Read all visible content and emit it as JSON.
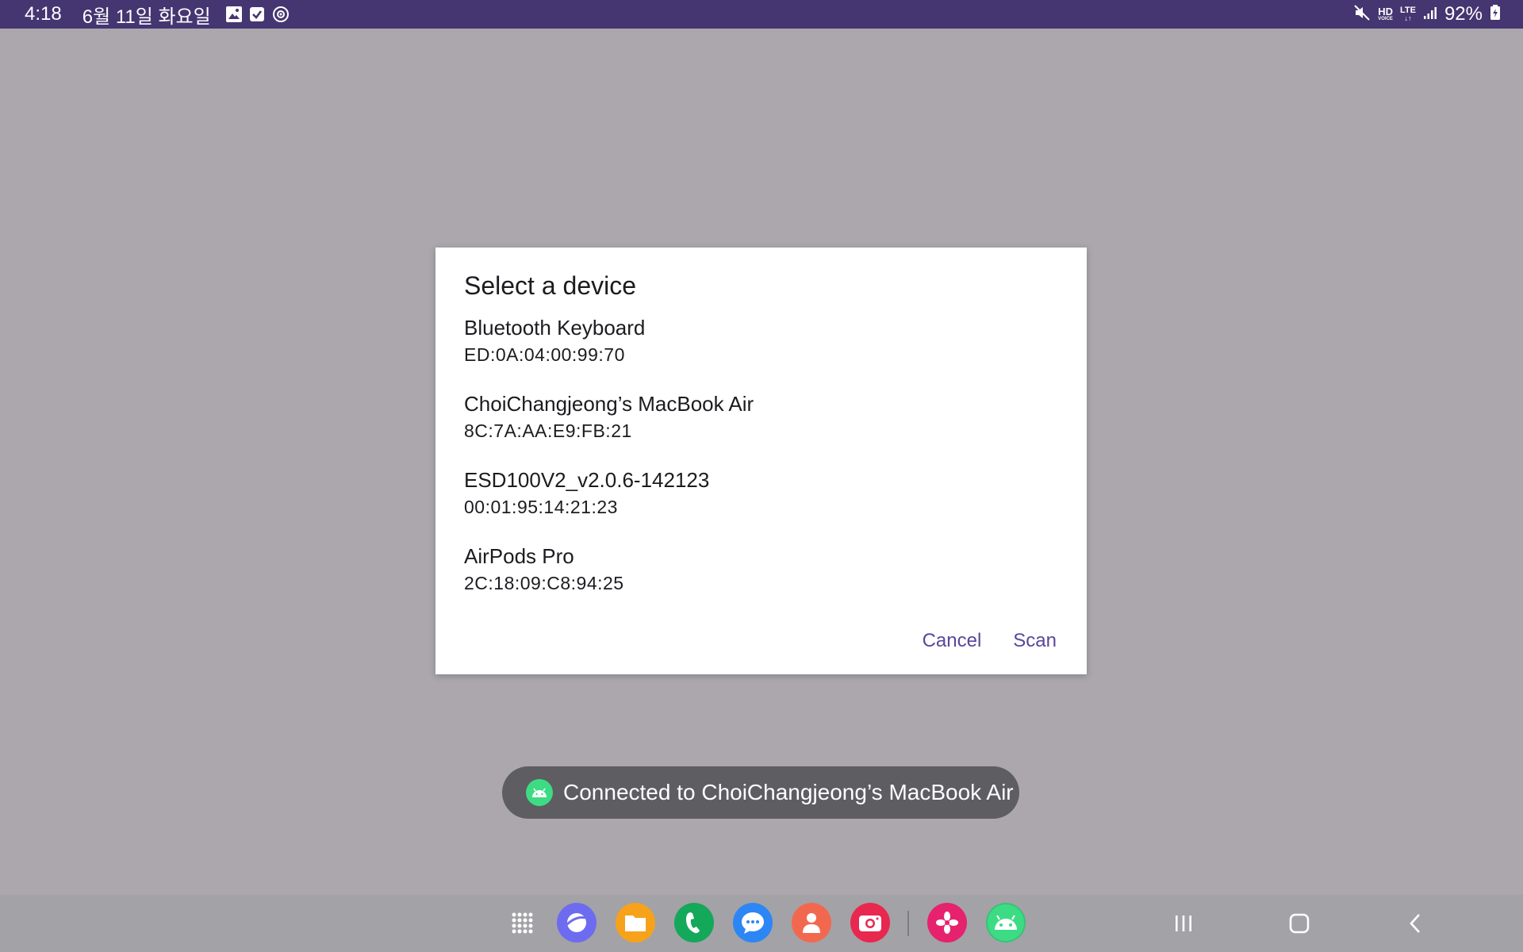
{
  "status_bar": {
    "time": "4:18",
    "date": "6월 11일 화요일",
    "left_icons": [
      "gallery-icon",
      "checkbox-icon",
      "sync-icon"
    ],
    "right_icons": [
      "mute-icon",
      "hd-voice-icon",
      "lte-icon",
      "signal-icon"
    ],
    "hd_label": "HD",
    "voice_label": "VOICE",
    "lte_label": "LTE",
    "battery_percent": "92%",
    "background": "#453571"
  },
  "dialog": {
    "title": "Select a device",
    "devices": [
      {
        "name": "Bluetooth Keyboard",
        "address": "ED:0A:04:00:99:70"
      },
      {
        "name": "ChoiChangjeong’s MacBook Air",
        "address": "8C:7A:AA:E9:FB:21"
      },
      {
        "name": "ESD100V2_v2.0.6-142123",
        "address": "00:01:95:14:21:23"
      },
      {
        "name": "AirPods Pro",
        "address": "2C:18:09:C8:94:25"
      }
    ],
    "cancel_label": "Cancel",
    "scan_label": "Scan",
    "accent_color": "#5a469b"
  },
  "toast": {
    "icon": "android-icon",
    "text": "Connected to ChoiChangjeong’s MacBook Air"
  },
  "taskbar": {
    "apps": [
      {
        "name": "apps-grid-icon"
      },
      {
        "name": "internet-browser-icon",
        "color": "#6d6cf0"
      },
      {
        "name": "my-files-icon",
        "color": "#f7a21b"
      },
      {
        "name": "phone-icon",
        "color": "#14a85a"
      },
      {
        "name": "messages-icon",
        "color": "#2c86f5"
      },
      {
        "name": "contacts-icon",
        "color": "#f2684f"
      },
      {
        "name": "camera-icon",
        "color": "#e8284f"
      },
      {
        "name": "gallery-app-icon",
        "color": "#e6226f"
      },
      {
        "name": "android-app-icon",
        "color": "#3ddc84"
      }
    ],
    "nav": [
      "recents-icon",
      "home-icon",
      "back-icon"
    ]
  }
}
